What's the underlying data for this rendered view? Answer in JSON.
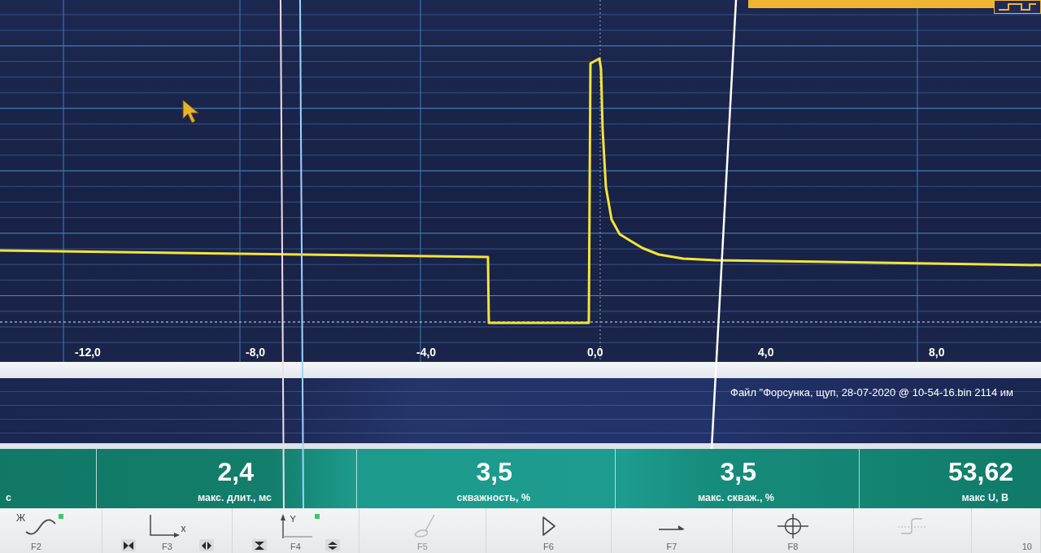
{
  "plot": {
    "x_labels": [
      "-12,0",
      "-8,0",
      "-4,0",
      "0,0",
      "4,0",
      "8,0"
    ]
  },
  "file_info": "Файл \"Форсунка, щуп, 28-07-2020 @ 10-54-16.bin 2114 им",
  "measurements": [
    {
      "label": "с"
    },
    {
      "value": "2,4",
      "label": "макс. длит., мс"
    },
    {
      "value": "3,5",
      "label": "скважность, %"
    },
    {
      "value": "3,5",
      "label": "макс. скваж., %"
    },
    {
      "value": "53,62",
      "label": "макс U, В"
    }
  ],
  "toolbar": [
    {
      "kind": "wave",
      "label": "F2",
      "icon_text": "Ж",
      "indicator": true,
      "disabled": false
    },
    {
      "kind": "x-axis",
      "label": "F3",
      "icon_text": "x",
      "indicator": false,
      "disabled": false
    },
    {
      "kind": "y-axis",
      "label": "F4",
      "icon_text": "Y",
      "indicator": true,
      "disabled": false
    },
    {
      "kind": "probe",
      "label": "F5",
      "indicator": false,
      "disabled": true
    },
    {
      "kind": "play",
      "label": "F6",
      "indicator": false,
      "disabled": false
    },
    {
      "kind": "arrow",
      "label": "F7",
      "indicator": false,
      "disabled": false
    },
    {
      "kind": "crosshair",
      "label": "F8",
      "indicator": false,
      "disabled": false
    },
    {
      "kind": "step",
      "indicator": false,
      "disabled": true
    },
    {
      "kind": "blank",
      "label": "10",
      "indicator": false,
      "disabled": false
    }
  ]
}
